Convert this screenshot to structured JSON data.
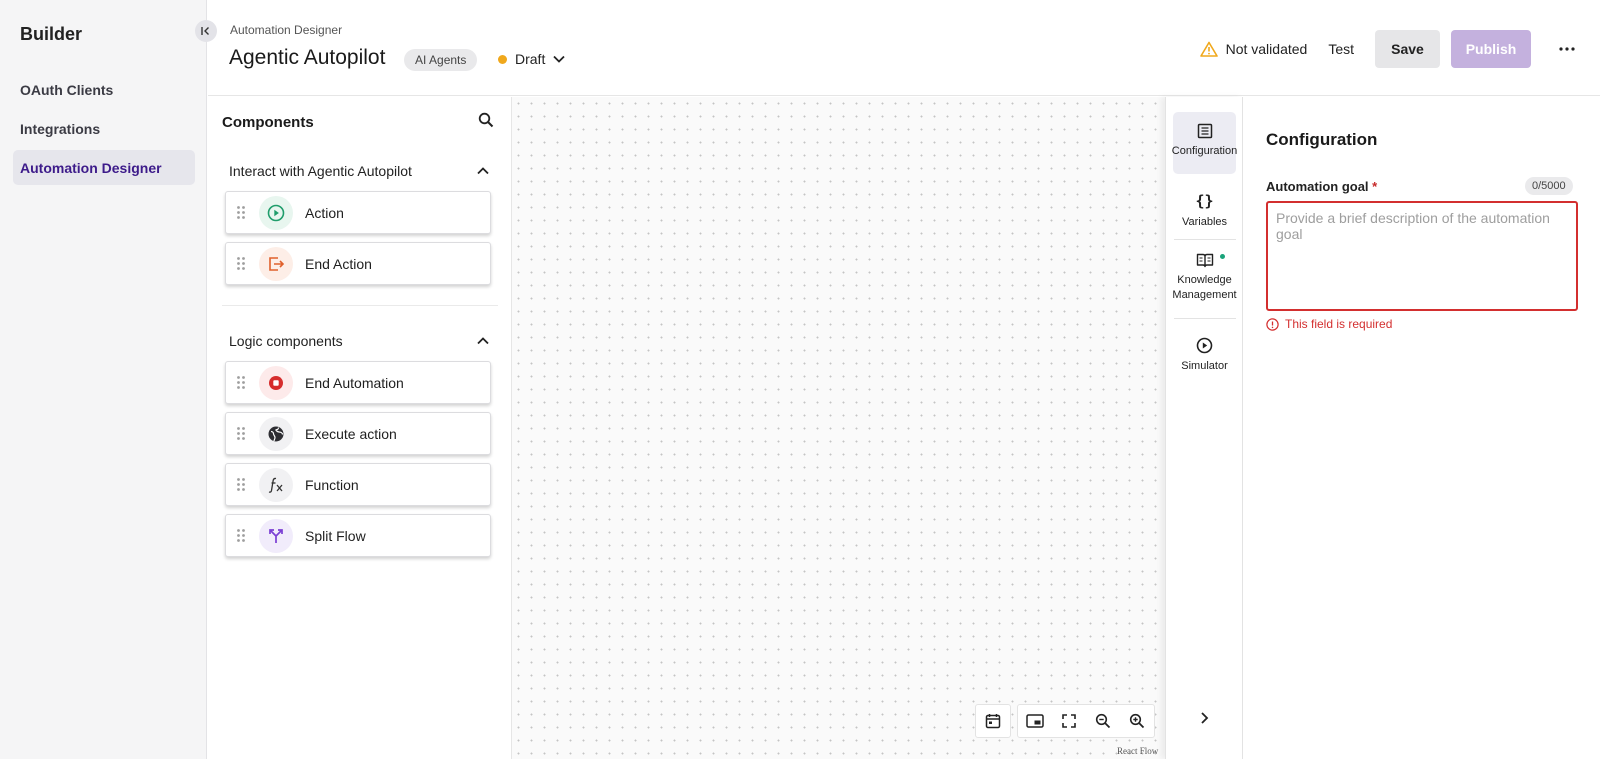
{
  "nav": {
    "title": "Builder",
    "items": [
      {
        "label": "OAuth Clients",
        "active": false
      },
      {
        "label": "Integrations",
        "active": false
      },
      {
        "label": "Automation Designer",
        "active": true
      }
    ]
  },
  "header": {
    "breadcrumb": "Automation Designer",
    "title": "Agentic Autopilot",
    "tag": "AI Agents",
    "status": "Draft",
    "validation": "Not validated",
    "test_label": "Test",
    "save_label": "Save",
    "publish_label": "Publish"
  },
  "components": {
    "title": "Components",
    "sections": [
      {
        "title": "Interact with Agentic Autopilot",
        "items": [
          {
            "label": "Action",
            "icon": "play-circle-icon"
          },
          {
            "label": "End Action",
            "icon": "exit-box-icon"
          }
        ]
      },
      {
        "title": "Logic components",
        "items": [
          {
            "label": "End Automation",
            "icon": "stop-circle-icon"
          },
          {
            "label": "Execute action",
            "icon": "globe-icon"
          },
          {
            "label": "Function",
            "icon": "function-icon"
          },
          {
            "label": "Split Flow",
            "icon": "split-arrows-icon"
          }
        ]
      }
    ]
  },
  "canvas": {
    "attribution": "React Flow"
  },
  "rail": {
    "tabs": [
      {
        "label": "Configuration",
        "active": true
      },
      {
        "label": "Variables",
        "active": false
      },
      {
        "label": "Knowledge Management",
        "active": false
      },
      {
        "label": "Simulator",
        "active": false
      }
    ]
  },
  "config": {
    "title": "Configuration",
    "goal_label": "Automation goal",
    "required_mark": "*",
    "counter": "0/5000",
    "goal_value": "",
    "goal_placeholder": "Provide a brief description of the automation goal",
    "error": "This field is required"
  },
  "colors": {
    "accent": "#3d1b8a",
    "publish_disabled": "#c4b1de",
    "error": "#d32f2f",
    "draft": "#f0a81c",
    "warning": "#f0a81c"
  }
}
